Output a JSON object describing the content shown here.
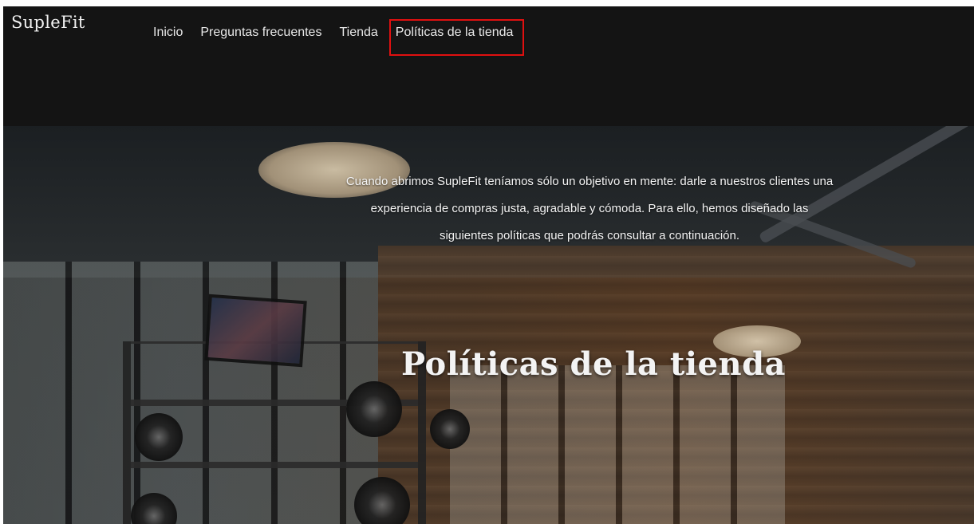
{
  "brand": {
    "name": "SupleFit"
  },
  "nav": {
    "items": [
      {
        "label": "Inicio"
      },
      {
        "label": "Preguntas frecuentes"
      },
      {
        "label": "Tienda"
      },
      {
        "label": "Políticas de la tienda",
        "active": true
      }
    ]
  },
  "hero": {
    "intro": "Cuando abrimos SupleFit teníamos sólo un objetivo en mente: darle a nuestros clientes una experiencia de compras justa, agradable y cómoda. Para ello, hemos diseñado las siguientes políticas que podrás consultar a continuación.",
    "title": "Políticas de la tienda"
  },
  "colors": {
    "header_bg": "#141414",
    "highlight_outline": "#e01010",
    "text_light": "#f4f4f4"
  }
}
